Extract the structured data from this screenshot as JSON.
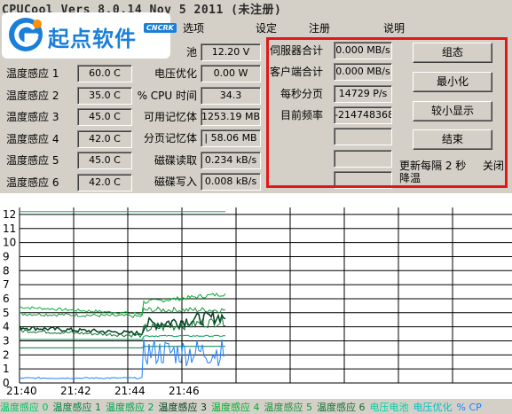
{
  "title": "CPUCool  Vers 8.0.14  Nov  5 2011 (未注册)",
  "logo": {
    "text": "起点软件",
    "badge": "CNCRK"
  },
  "menu": [
    "选项",
    "设定",
    "注册",
    "说明"
  ],
  "temps": [
    {
      "label": "温度感应 1",
      "value": "60.0 C"
    },
    {
      "label": "温度感应 2",
      "value": "35.0 C"
    },
    {
      "label": "温度感应 3",
      "value": "45.0 C"
    },
    {
      "label": "温度感应 4",
      "value": "42.0 C"
    },
    {
      "label": "温度感应 5",
      "value": "45.0 C"
    },
    {
      "label": "温度感应 6",
      "value": "42.0 C"
    }
  ],
  "power": [
    {
      "label": "池",
      "value": "12.20 V"
    },
    {
      "label": "电压优化",
      "value": "0.00 W"
    },
    {
      "label": "% CPU 时间",
      "value": "34.3"
    },
    {
      "label": "可用记忆体",
      "value": "1253.19 MB"
    },
    {
      "label": "分页记忆体",
      "value": "| 58.06 MB"
    },
    {
      "label": "磁碟读取",
      "value": "0.234 kB/s"
    },
    {
      "label": "磁碟写入",
      "value": "0.008 kB/s"
    }
  ],
  "net": [
    {
      "label": "伺服器合计",
      "value": "0.000 MB/s"
    },
    {
      "label": "客户端合计",
      "value": "0.000 MB/s"
    },
    {
      "label": "每秒分页",
      "value": "14729 P/s"
    },
    {
      "label": "目前频率",
      "value": "-214748368.0"
    },
    {
      "label": "",
      "value": ""
    },
    {
      "label": "",
      "value": ""
    },
    {
      "label": "",
      "value": ""
    }
  ],
  "buttons": [
    "组态",
    "最小化",
    "较小显示",
    "结束"
  ],
  "refresh_text": "更新每隔 2 秒",
  "close_text": "关闭",
  "cool_text": "降温",
  "chart_data": {
    "type": "line",
    "y_ticks": [
      "12",
      "11",
      "10",
      "9",
      "8",
      "7",
      "6",
      "5",
      "4",
      "3",
      "2",
      "1",
      "0"
    ],
    "x_ticks": [
      "21:40",
      "21:42",
      "21:44",
      "21:46"
    ],
    "ylim": [
      0,
      12.5
    ],
    "grid": true,
    "series": [
      {
        "name": "温度感应 0",
        "color": "#00c060"
      },
      {
        "name": "温度感应 1",
        "color": "#008040"
      },
      {
        "name": "温度感应 2",
        "color": "#00a050"
      },
      {
        "name": "温度感应 3",
        "color": "#004020"
      },
      {
        "name": "温度感应 4",
        "color": "#00b030"
      },
      {
        "name": "温度感应 5",
        "color": "#209040"
      },
      {
        "name": "温度感应 6",
        "color": "#107030"
      },
      {
        "name": "电压电池",
        "color": "#00d0a0"
      },
      {
        "name": "电压优化",
        "color": "#00c0c0"
      },
      {
        "name": "% CP",
        "color": "#2080ff"
      }
    ]
  }
}
